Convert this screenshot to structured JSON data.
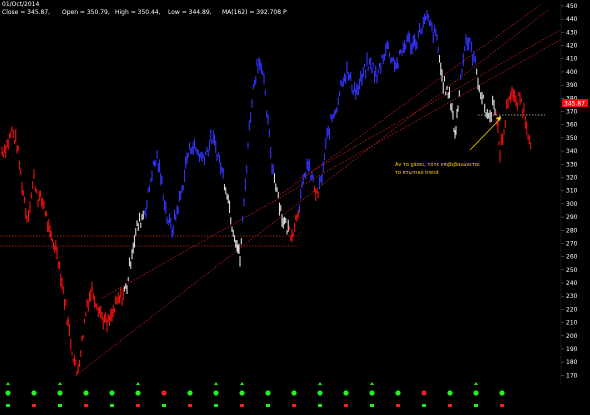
{
  "header": {
    "date": "01/Oct/2014",
    "close_label": "Close = 345.87,",
    "open_label": "Open = 350.79,",
    "high_label": "High = 350.44,",
    "low_label": "Low = 344.89,",
    "ma_label": "MA(162) = 392.708",
    "ma_flag": "P"
  },
  "annotation": {
    "line1": "Αν το χάσει, τότε επιβεβαιώνεται",
    "line2": "το πτωτικό trend"
  },
  "price_badge": "345.87",
  "colors": {
    "background": "#000000",
    "up_trend": "#3333ff",
    "down_trend": "#ee1111",
    "neutral": "#dddddd",
    "trendline": "#cc2222",
    "support_line": "#cc2222",
    "annotation": "#ffd700",
    "signal_green": "#22ee22",
    "signal_red": "#ee2222"
  },
  "chart_data": {
    "type": "line",
    "title": "",
    "xlabel": "",
    "ylabel": "",
    "ylim": [
      165,
      453
    ],
    "y_ticks": [
      170,
      180,
      190,
      200,
      210,
      220,
      230,
      240,
      250,
      260,
      270,
      280,
      290,
      300,
      310,
      320,
      330,
      340,
      350,
      360,
      370,
      380,
      390,
      400,
      410,
      420,
      430,
      440,
      450
    ],
    "grid": false,
    "series": [
      {
        "values": [
          {
            "x": 0,
            "y": 340,
            "c": "red"
          },
          {
            "x": 5,
            "y": 345,
            "c": "red"
          },
          {
            "x": 10,
            "y": 355,
            "c": "red"
          },
          {
            "x": 15,
            "y": 345,
            "c": "red"
          },
          {
            "x": 20,
            "y": 315,
            "c": "red"
          },
          {
            "x": 25,
            "y": 290,
            "c": "red"
          },
          {
            "x": 28,
            "y": 300,
            "c": "red"
          },
          {
            "x": 32,
            "y": 320,
            "c": "red"
          },
          {
            "x": 36,
            "y": 305,
            "c": "red"
          },
          {
            "x": 42,
            "y": 300,
            "c": "red"
          },
          {
            "x": 48,
            "y": 275,
            "c": "red"
          },
          {
            "x": 55,
            "y": 265,
            "c": "red"
          },
          {
            "x": 60,
            "y": 240,
            "c": "red"
          },
          {
            "x": 65,
            "y": 215,
            "c": "red"
          },
          {
            "x": 70,
            "y": 190,
            "c": "red"
          },
          {
            "x": 75,
            "y": 172,
            "c": "red"
          },
          {
            "x": 80,
            "y": 195,
            "c": "red"
          },
          {
            "x": 85,
            "y": 225,
            "c": "red"
          },
          {
            "x": 90,
            "y": 235,
            "c": "red"
          },
          {
            "x": 95,
            "y": 225,
            "c": "red"
          },
          {
            "x": 100,
            "y": 215,
            "c": "red"
          },
          {
            "x": 105,
            "y": 208,
            "c": "red"
          },
          {
            "x": 110,
            "y": 215,
            "c": "red"
          },
          {
            "x": 115,
            "y": 225,
            "c": "red"
          },
          {
            "x": 120,
            "y": 230,
            "c": "red"
          },
          {
            "x": 125,
            "y": 238,
            "c": "white"
          },
          {
            "x": 130,
            "y": 265,
            "c": "white"
          },
          {
            "x": 135,
            "y": 282,
            "c": "white"
          },
          {
            "x": 140,
            "y": 290,
            "c": "white"
          },
          {
            "x": 145,
            "y": 300,
            "c": "blue"
          },
          {
            "x": 150,
            "y": 325,
            "c": "blue"
          },
          {
            "x": 155,
            "y": 335,
            "c": "blue"
          },
          {
            "x": 160,
            "y": 315,
            "c": "blue"
          },
          {
            "x": 165,
            "y": 290,
            "c": "blue"
          },
          {
            "x": 170,
            "y": 280,
            "c": "blue"
          },
          {
            "x": 175,
            "y": 295,
            "c": "blue"
          },
          {
            "x": 180,
            "y": 310,
            "c": "blue"
          },
          {
            "x": 185,
            "y": 335,
            "c": "blue"
          },
          {
            "x": 190,
            "y": 345,
            "c": "blue"
          },
          {
            "x": 195,
            "y": 340,
            "c": "blue"
          },
          {
            "x": 200,
            "y": 335,
            "c": "blue"
          },
          {
            "x": 205,
            "y": 340,
            "c": "blue"
          },
          {
            "x": 210,
            "y": 350,
            "c": "blue"
          },
          {
            "x": 215,
            "y": 340,
            "c": "blue"
          },
          {
            "x": 220,
            "y": 325,
            "c": "blue"
          },
          {
            "x": 225,
            "y": 310,
            "c": "white"
          },
          {
            "x": 230,
            "y": 285,
            "c": "white"
          },
          {
            "x": 235,
            "y": 270,
            "c": "white"
          },
          {
            "x": 238,
            "y": 258,
            "c": "white"
          },
          {
            "x": 242,
            "y": 300,
            "c": "blue"
          },
          {
            "x": 246,
            "y": 345,
            "c": "blue"
          },
          {
            "x": 250,
            "y": 380,
            "c": "blue"
          },
          {
            "x": 255,
            "y": 405,
            "c": "blue"
          },
          {
            "x": 258,
            "y": 410,
            "c": "blue"
          },
          {
            "x": 262,
            "y": 390,
            "c": "blue"
          },
          {
            "x": 266,
            "y": 360,
            "c": "blue"
          },
          {
            "x": 270,
            "y": 330,
            "c": "blue"
          },
          {
            "x": 275,
            "y": 312,
            "c": "white"
          },
          {
            "x": 280,
            "y": 290,
            "c": "white"
          },
          {
            "x": 285,
            "y": 282,
            "c": "white"
          },
          {
            "x": 290,
            "y": 278,
            "c": "red"
          },
          {
            "x": 295,
            "y": 292,
            "c": "red"
          },
          {
            "x": 300,
            "y": 310,
            "c": "blue"
          },
          {
            "x": 305,
            "y": 330,
            "c": "blue"
          },
          {
            "x": 310,
            "y": 320,
            "c": "blue"
          },
          {
            "x": 315,
            "y": 305,
            "c": "red"
          },
          {
            "x": 320,
            "y": 320,
            "c": "blue"
          },
          {
            "x": 325,
            "y": 350,
            "c": "blue"
          },
          {
            "x": 330,
            "y": 365,
            "c": "blue"
          },
          {
            "x": 335,
            "y": 375,
            "c": "blue"
          },
          {
            "x": 340,
            "y": 395,
            "c": "blue"
          },
          {
            "x": 345,
            "y": 400,
            "c": "blue"
          },
          {
            "x": 350,
            "y": 390,
            "c": "blue"
          },
          {
            "x": 355,
            "y": 385,
            "c": "blue"
          },
          {
            "x": 360,
            "y": 395,
            "c": "blue"
          },
          {
            "x": 365,
            "y": 405,
            "c": "blue"
          },
          {
            "x": 370,
            "y": 405,
            "c": "blue"
          },
          {
            "x": 375,
            "y": 395,
            "c": "blue"
          },
          {
            "x": 380,
            "y": 410,
            "c": "blue"
          },
          {
            "x": 385,
            "y": 420,
            "c": "blue"
          },
          {
            "x": 390,
            "y": 410,
            "c": "blue"
          },
          {
            "x": 395,
            "y": 405,
            "c": "blue"
          },
          {
            "x": 400,
            "y": 415,
            "c": "blue"
          },
          {
            "x": 405,
            "y": 425,
            "c": "blue"
          },
          {
            "x": 410,
            "y": 420,
            "c": "blue"
          },
          {
            "x": 415,
            "y": 425,
            "c": "blue"
          },
          {
            "x": 420,
            "y": 435,
            "c": "blue"
          },
          {
            "x": 425,
            "y": 440,
            "c": "blue"
          },
          {
            "x": 430,
            "y": 432,
            "c": "blue"
          },
          {
            "x": 435,
            "y": 425,
            "c": "blue"
          },
          {
            "x": 440,
            "y": 395,
            "c": "white"
          },
          {
            "x": 445,
            "y": 385,
            "c": "white"
          },
          {
            "x": 450,
            "y": 375,
            "c": "white"
          },
          {
            "x": 453,
            "y": 350,
            "c": "white"
          },
          {
            "x": 456,
            "y": 375,
            "c": "white"
          },
          {
            "x": 460,
            "y": 405,
            "c": "blue"
          },
          {
            "x": 464,
            "y": 425,
            "c": "blue"
          },
          {
            "x": 468,
            "y": 420,
            "c": "blue"
          },
          {
            "x": 472,
            "y": 410,
            "c": "blue"
          },
          {
            "x": 476,
            "y": 395,
            "c": "white"
          },
          {
            "x": 480,
            "y": 380,
            "c": "white"
          },
          {
            "x": 484,
            "y": 370,
            "c": "white"
          },
          {
            "x": 488,
            "y": 365,
            "c": "white"
          },
          {
            "x": 492,
            "y": 380,
            "c": "white"
          },
          {
            "x": 495,
            "y": 360,
            "c": "red"
          },
          {
            "x": 498,
            "y": 340,
            "c": "red"
          },
          {
            "x": 502,
            "y": 355,
            "c": "red"
          },
          {
            "x": 506,
            "y": 380,
            "c": "red"
          },
          {
            "x": 510,
            "y": 385,
            "c": "red"
          },
          {
            "x": 514,
            "y": 375,
            "c": "red"
          },
          {
            "x": 518,
            "y": 380,
            "c": "red"
          },
          {
            "x": 522,
            "y": 370,
            "c": "red"
          },
          {
            "x": 526,
            "y": 355,
            "c": "red"
          },
          {
            "x": 530,
            "y": 346,
            "c": "red"
          }
        ]
      }
    ]
  },
  "signals": [
    "up",
    "neutral",
    "up",
    "neutral",
    "neutral",
    "up",
    "down",
    "neutral",
    "up",
    "up",
    "neutral",
    "neutral",
    "up",
    "neutral",
    "up",
    "neutral",
    "down",
    "neutral",
    "up",
    "neutral"
  ]
}
